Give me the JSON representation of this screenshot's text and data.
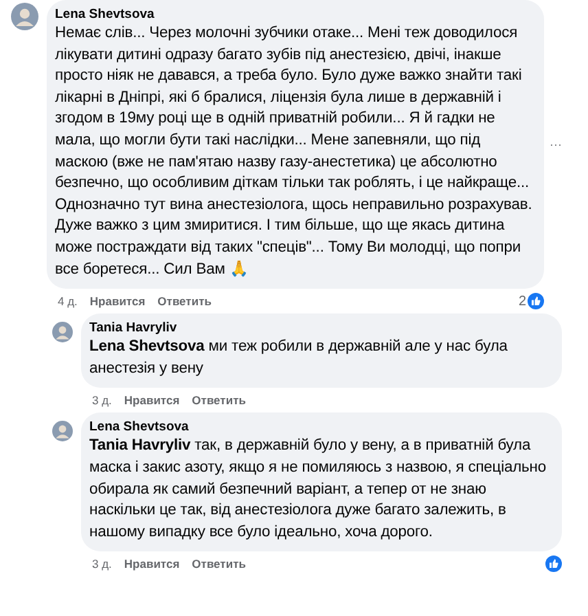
{
  "comments": [
    {
      "author": "Lena Shevtsova",
      "text": "Немає слів... Через молочні зубчики отаке... Мені теж доводилося лікувати дитині одразу багато зубів під анестезією, двічі, інакше просто ніяк не давався, а треба було. Було дуже важко знайти такі лікарні в Дніпрі, які б бралися, ліцензія була лише в державній і згодом в 19му році ще в одній приватній робили... Я й гадки не мала, що могли бути такі наслідки... Мене запевняли, що під маскою (вже не пам'ятаю назву газу-анестетика) це абсолютно безпечно, що особливим діткам тільки так роблять, і це найкраще... Однозначно тут вина анестезіолога, щось неправильно розрахував. Дуже важко з цим змиритися. І тим більше, що ще якась дитина може постраждати від таких \"спеців\"... Тому Ви молодці, що попри все боретеся... Сил Вам 🙏",
      "time": "4 д.",
      "like": "Нравится",
      "reply": "Ответить",
      "reaction_count": "2",
      "has_reaction": true,
      "more": "···",
      "reply_level": false
    },
    {
      "author": "Tania Havryliv",
      "text": "**Lena Shevtsova** ми теж робили в державній але у нас була анестезія у вену",
      "time": "3 д.",
      "like": "Нравится",
      "reply": "Ответить",
      "has_reaction": false,
      "reply_level": true
    },
    {
      "author": "Lena Shevtsova",
      "text": "**Tania Havryliv** так, в державній було у вену, а в приватній була маска і закис азоту, якщо я не помиляюсь з назвою, я спеціально обирала як самий безпечний варіант, а тепер от не знаю наскільки це так, від анестезіолога дуже багато залежить, в нашому випадку все було ідеально, хоча дорого.",
      "time": "3 д.",
      "like": "Нравится",
      "reply": "Ответить",
      "has_reaction": true,
      "reply_level": true
    }
  ]
}
